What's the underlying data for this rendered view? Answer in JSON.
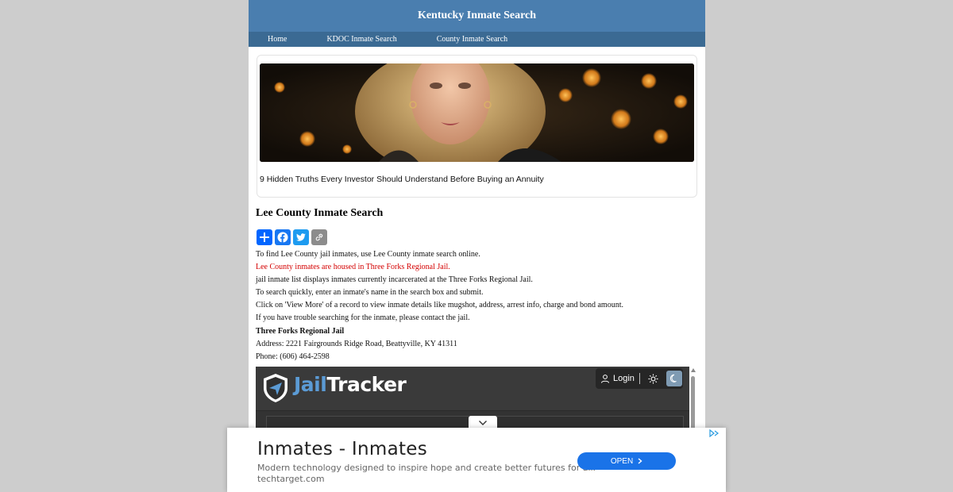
{
  "header": {
    "title": "Kentucky Inmate Search"
  },
  "nav": {
    "items": [
      "Home",
      "KDOC Inmate Search",
      "County Inmate Search"
    ]
  },
  "ad_card": {
    "headline": "9 Hidden Truths Every Investor Should Understand Before Buying an Annuity"
  },
  "page_title": "Lee County Inmate Search",
  "share": {
    "icons": [
      "addtoany-plus-icon",
      "facebook-icon",
      "twitter-icon",
      "copy-link-icon"
    ]
  },
  "intro": {
    "line1": "To find Lee County jail inmates, use Lee County inmate search online.",
    "line2": "Lee County inmates are housed in Three Forks Regional Jail.",
    "line3": "jail inmate list displays inmates currently incarcerated at the Three Forks Regional Jail.",
    "line4": "To search quickly, enter an inmate's name in the search box and submit.",
    "line5": "Click on 'View More' of a record to view inmate details like mugshot, address, arrest info, charge and bond amount.",
    "line6": "If you have trouble searching for the inmate, please contact the jail."
  },
  "jail": {
    "name": "Three Forks Regional Jail",
    "address": "Address: 2221 Fairgrounds Ridge Road, Beattyville, KY 41311",
    "phone": "Phone: (606) 464-2598"
  },
  "tracker": {
    "logo_part1": "Jail",
    "logo_part2": "Tracker",
    "login_label": "Login"
  },
  "bottom_ad": {
    "title": "Inmates - Inmates",
    "description": "Modern technology designed to inspire hope and create better futures for all.",
    "domain": "techtarget.com",
    "button_label": "OPEN"
  },
  "colors": {
    "header_bg": "#4a7eaf",
    "nav_bg": "#3b6a93",
    "red_text": "#d40000",
    "tracker_blue": "#5b9bd5",
    "open_button": "#1a73e8"
  }
}
